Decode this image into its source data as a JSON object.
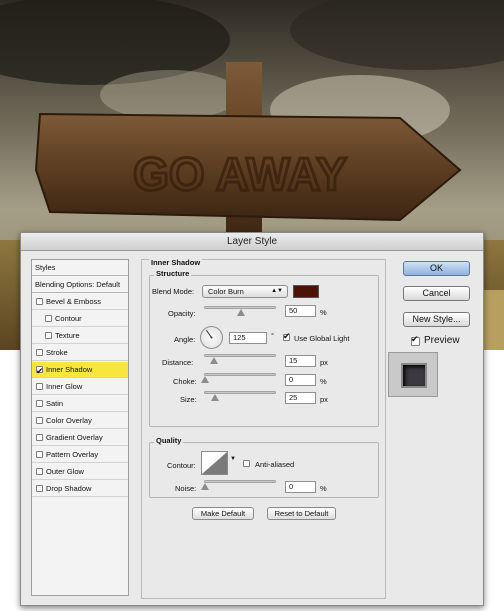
{
  "window": {
    "title": "Layer Style"
  },
  "styles_panel": {
    "header": "Styles",
    "blending_options": "Blending Options: Default",
    "items": [
      {
        "label": "Bevel & Emboss",
        "checked": false,
        "indent": false,
        "selected": false
      },
      {
        "label": "Contour",
        "checked": false,
        "indent": true,
        "selected": false
      },
      {
        "label": "Texture",
        "checked": false,
        "indent": true,
        "selected": false
      },
      {
        "label": "Stroke",
        "checked": false,
        "indent": false,
        "selected": false
      },
      {
        "label": "Inner Shadow",
        "checked": true,
        "indent": false,
        "selected": true
      },
      {
        "label": "Inner Glow",
        "checked": false,
        "indent": false,
        "selected": false
      },
      {
        "label": "Satin",
        "checked": false,
        "indent": false,
        "selected": false
      },
      {
        "label": "Color Overlay",
        "checked": false,
        "indent": false,
        "selected": false
      },
      {
        "label": "Gradient Overlay",
        "checked": false,
        "indent": false,
        "selected": false
      },
      {
        "label": "Pattern Overlay",
        "checked": false,
        "indent": false,
        "selected": false
      },
      {
        "label": "Outer Glow",
        "checked": false,
        "indent": false,
        "selected": false
      },
      {
        "label": "Drop Shadow",
        "checked": false,
        "indent": false,
        "selected": false
      }
    ]
  },
  "inner_shadow": {
    "section_title": "Inner Shadow",
    "structure": {
      "title": "Structure",
      "blend_mode_label": "Blend Mode:",
      "blend_mode_value": "Color Burn",
      "shadow_color": "#4a1506",
      "opacity_label": "Opacity:",
      "opacity_value": "50",
      "opacity_unit": "%",
      "opacity_level": 0.5,
      "angle_label": "Angle:",
      "angle_value": "125",
      "angle_unit": "°",
      "use_global_light_label": "Use Global Light",
      "use_global_light_checked": true,
      "distance_label": "Distance:",
      "distance_value": "15",
      "distance_unit": "px",
      "choke_label": "Choke:",
      "choke_value": "0",
      "choke_unit": "%",
      "size_label": "Size:",
      "size_value": "25",
      "size_unit": "px"
    },
    "quality": {
      "title": "Quality",
      "contour_label": "Contour:",
      "anti_aliased_label": "Anti-aliased",
      "anti_aliased_checked": false,
      "noise_label": "Noise:",
      "noise_value": "0",
      "noise_unit": "%"
    },
    "make_default_label": "Make Default",
    "reset_default_label": "Reset to Default"
  },
  "actions": {
    "ok_label": "OK",
    "cancel_label": "Cancel",
    "new_style_label": "New Style...",
    "preview_label": "Preview",
    "preview_checked": true
  },
  "photo": {
    "sign_text": "GO AWAY"
  }
}
